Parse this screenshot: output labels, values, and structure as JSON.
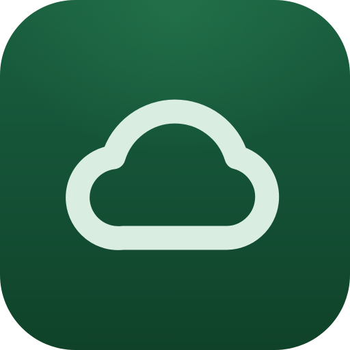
{
  "app_icon": {
    "icon_name": "cloud-icon",
    "background_color": "#175a3b",
    "glyph_color": "#d9ede0"
  }
}
